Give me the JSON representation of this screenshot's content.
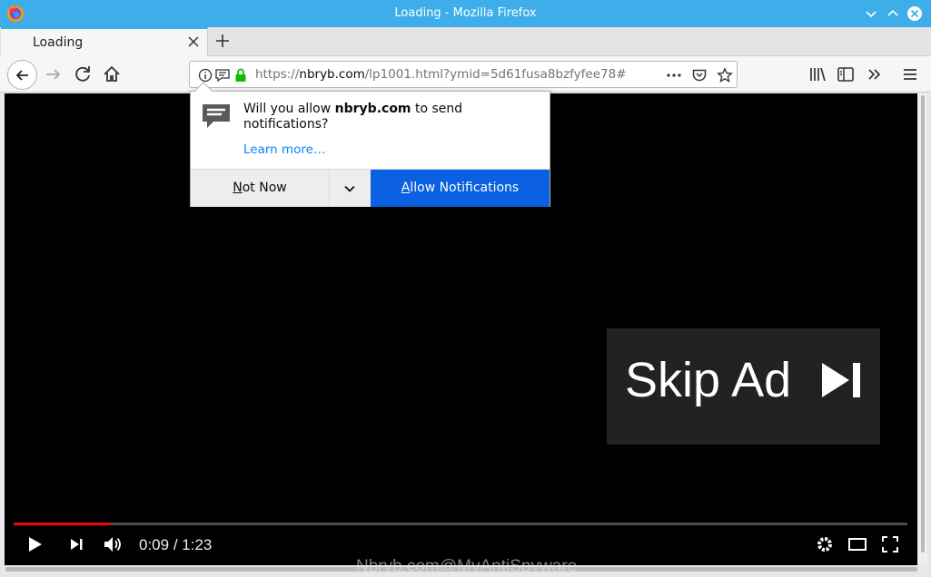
{
  "window": {
    "title": "Loading - Mozilla Firefox",
    "brand_color": "#3daee9"
  },
  "tabs": [
    {
      "label": "Loading",
      "active": true
    }
  ],
  "toolbar": {
    "url_prefix": "https://",
    "url_domain": "nbryb.com",
    "url_path": "/lp1001.html?ymid=5d61fusa8bzfyfee78#",
    "icons": [
      "back-icon",
      "forward-icon",
      "reload-icon",
      "home-icon",
      "info-icon",
      "notification-permission-icon",
      "lock-icon",
      "page-actions-icon",
      "pocket-icon",
      "bookmark-star-icon",
      "library-icon",
      "sidebar-icon",
      "overflow-icon",
      "menu-icon"
    ]
  },
  "notification_popup": {
    "message_before": "Will you allow ",
    "message_domain": "nbryb.com",
    "message_after": " to send notifications?",
    "learn_more": "Learn more…",
    "not_now_label": "Not Now",
    "allow_label": "Allow Notifications",
    "allow_color": "#0a60e0"
  },
  "video": {
    "skip_ad_label": "Skip Ad",
    "current_time": "0:09",
    "time_separator": " / ",
    "duration": "1:23",
    "progress_fraction": 0.108,
    "progress_color": "#ff0000"
  },
  "watermark": "Nbryb.com@MyAntiSpyware"
}
